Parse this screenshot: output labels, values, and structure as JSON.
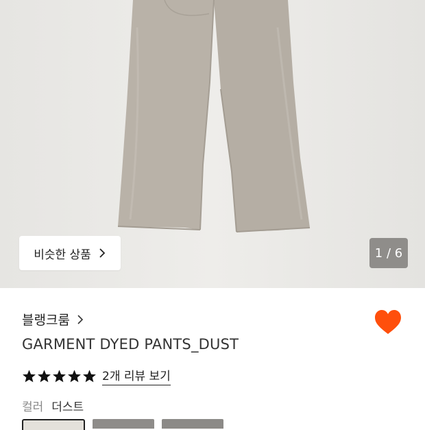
{
  "gallery": {
    "similar_button_label": "비슷한 상품",
    "counter": "1 / 6"
  },
  "product": {
    "brand": "블랭크룸",
    "name": "GARMENT DYED PANTS_DUST",
    "review_link": "2개 리뷰 보기",
    "rating": 5,
    "color_label": "컬러",
    "color_value": "더스트",
    "wishlist_color": "#ff4f0c"
  },
  "swatches": [
    {
      "name": "dust",
      "color": "#e4e1db",
      "selected": true
    },
    {
      "name": "swatch-2",
      "color": "#8e8c89",
      "selected": false
    },
    {
      "name": "swatch-3",
      "color": "#8c8a87",
      "selected": false
    }
  ],
  "icons": {
    "similar_chevron": "chevron-right-icon",
    "brand_chevron": "chevron-right-icon",
    "wishlist": "heart-icon",
    "star": "star-icon"
  }
}
